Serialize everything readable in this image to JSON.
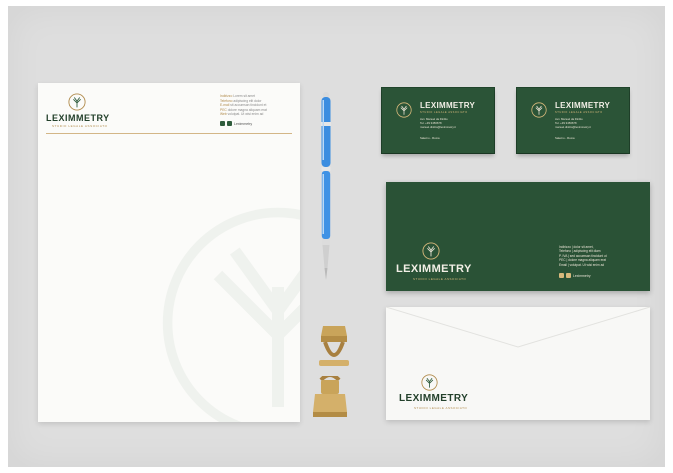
{
  "brand": {
    "name": "LEXIMMETRY",
    "tagline": "STUDIO LEGALE ASSOCIATO"
  },
  "letterhead": {
    "contact_lines": [
      [
        "Indirizzo",
        " Lorem sit amet"
      ],
      [
        "Telefono",
        " adipiscing elit dolor"
      ],
      [
        "E-mail",
        " sit accumsan tincidunt et"
      ],
      [
        "PEC",
        " dolore magna aliquam erat"
      ],
      [
        "Web",
        " volutpat. Ut wisi enim ad"
      ]
    ],
    "social": "Leximmetry"
  },
  "cards": [
    {
      "person_lines": [
        "Avv. Manuel da Dinitto",
        "Tel. +39 3456678",
        "manuel.dinitto@leximmetry.it"
      ],
      "city": "Salerno - Roma"
    },
    {
      "person_lines": [
        "Avv. Manuel da Dinitto",
        "Tel. +39 3456678",
        "manuel.dinitto@leximmetry.it"
      ],
      "city": "Salerno - Roma"
    }
  ],
  "green_envelope": {
    "contact_lines": [
      "Indirizzo | dolor sit amet,",
      "Telefono | adipiscing elit diam",
      "P. IVA | sed accumsan tincidunt ut",
      "PEC | dolore magna aliquam erat",
      "Email | volutpat. Ut wisi enim ad"
    ],
    "social": "Leximmetry"
  },
  "colors": {
    "brand_green": "#2b5437",
    "accent_gold": "#c9a56a",
    "paper": "#fbfbf9",
    "backdrop": "#dedede"
  }
}
